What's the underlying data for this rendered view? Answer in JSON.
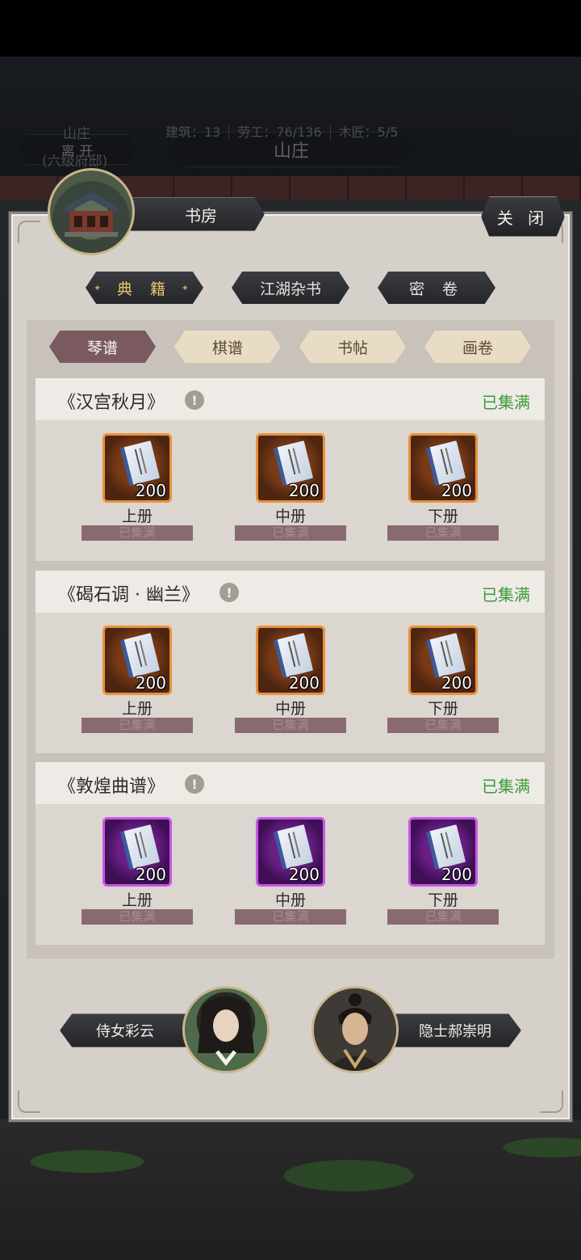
{
  "background": {
    "leave_label": "离 开",
    "estate_title": "山庄",
    "estate_name": "山庄",
    "estate_rank": "(六级府邸)",
    "stats": [
      "建筑：13",
      "劳工：76/136",
      "木匠：5/5"
    ]
  },
  "dialog": {
    "title": "书房",
    "close_label": "关 闭",
    "main_tabs": [
      "典 籍",
      "江湖杂书",
      "密 卷"
    ],
    "active_main_tab": 0,
    "sub_tabs": [
      "琴谱",
      "棋谱",
      "书帖",
      "画卷"
    ],
    "active_sub_tab": 0,
    "sections": [
      {
        "title": "《汉宫秋月》",
        "info": "!",
        "status": "已集满",
        "quality": "orange",
        "volumes": [
          {
            "label": "上册",
            "count": "200",
            "status": "已集满"
          },
          {
            "label": "中册",
            "count": "200",
            "status": "已集满"
          },
          {
            "label": "下册",
            "count": "200",
            "status": "已集满"
          }
        ]
      },
      {
        "title": "《碣石调 · 幽兰》",
        "info": "!",
        "status": "已集满",
        "quality": "orange",
        "volumes": [
          {
            "label": "上册",
            "count": "200",
            "status": "已集满"
          },
          {
            "label": "中册",
            "count": "200",
            "status": "已集满"
          },
          {
            "label": "下册",
            "count": "200",
            "status": "已集满"
          }
        ]
      },
      {
        "title": "《敦煌曲谱》",
        "info": "!",
        "status": "已集满",
        "quality": "purple",
        "volumes": [
          {
            "label": "上册",
            "count": "200",
            "status": "已集满"
          },
          {
            "label": "中册",
            "count": "200",
            "status": "已集满"
          },
          {
            "label": "下册",
            "count": "200",
            "status": "已集满"
          }
        ]
      }
    ],
    "characters": [
      {
        "name": "侍女彩云"
      },
      {
        "name": "隐士郝崇明"
      }
    ]
  },
  "colors": {
    "status_green": "#3c9a3a",
    "active_sub_tab": "#7a5a60",
    "orange_frame": "#e9923a",
    "purple_frame": "#c958e8"
  }
}
